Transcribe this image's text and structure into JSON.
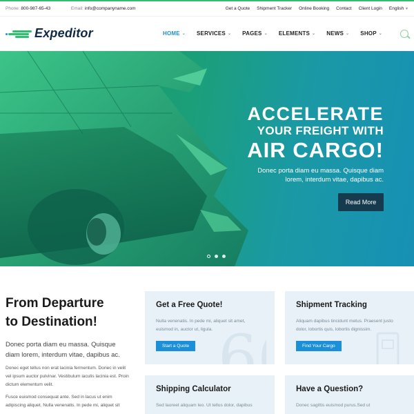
{
  "topbar": {
    "phone_label": "Phone:",
    "phone": "800-987-65-43",
    "email_label": "Email:",
    "email": "info@companyname.com",
    "links": [
      "Get a Quote",
      "Shipment Tracker",
      "Online Booking",
      "Contact",
      "Client Login",
      "English"
    ]
  },
  "header": {
    "logo_text": "Expeditor",
    "nav": [
      "HOME",
      "SERVICES",
      "PAGES",
      "ELEMENTS",
      "NEWS",
      "SHOP"
    ],
    "active_nav": "HOME"
  },
  "hero": {
    "line1": "ACCELERATE",
    "line2": "YOUR FREIGHT WITH",
    "line3": "AIR CARGO!",
    "desc1": "Donec porta diam eu massa. Quisque diam",
    "desc2": "lorem, interdum vitae, dapibus ac.",
    "button": "Read More",
    "slides": 3,
    "active_slide": 1
  },
  "intro": {
    "title1": "From Departure",
    "title2": "to Destination!",
    "lead": "Donec porta diam eu massa. Quisque diam lorem, interdum vitae, dapibus ac.",
    "p1": "Donec eget tellus non erat lacinia fermentum. Donec in velit vel ipsum auctor pulvinar. Vestibulum iaculis lacinia est. Proin dictum elementum velit.",
    "p2": "Fusce euismod consequat ante. Sed in lacus ut enim adipiscing aliquet. Nulla venenatis. In pede mi, aliquet sit"
  },
  "cards": [
    {
      "title": "Get a Free Quote!",
      "text": "Nulla venenatis. In pede mi, aliquet sit amet, euismod in, auctor ut, ligula.",
      "button": "Start a Quote"
    },
    {
      "title": "Shipment Tracking",
      "text": "Aliquam dapibus tincidunt metus. Praesent justo dolor, lobortis quis, lobortis dignissim.",
      "button": "Find Your Cargo"
    },
    {
      "title": "Shipping Calculator",
      "text": "Sed laoreet aliquam leo. Ut tellus dolor, dapibus"
    },
    {
      "title": "Have a Question?",
      "text": "Donec sagittis euismod purus.Sed ut"
    }
  ],
  "colors": {
    "accent": "#1b8fd8",
    "brand_green": "#2fbf71",
    "dark_button": "#173b4e",
    "card_bg": "#e8f1f7"
  }
}
